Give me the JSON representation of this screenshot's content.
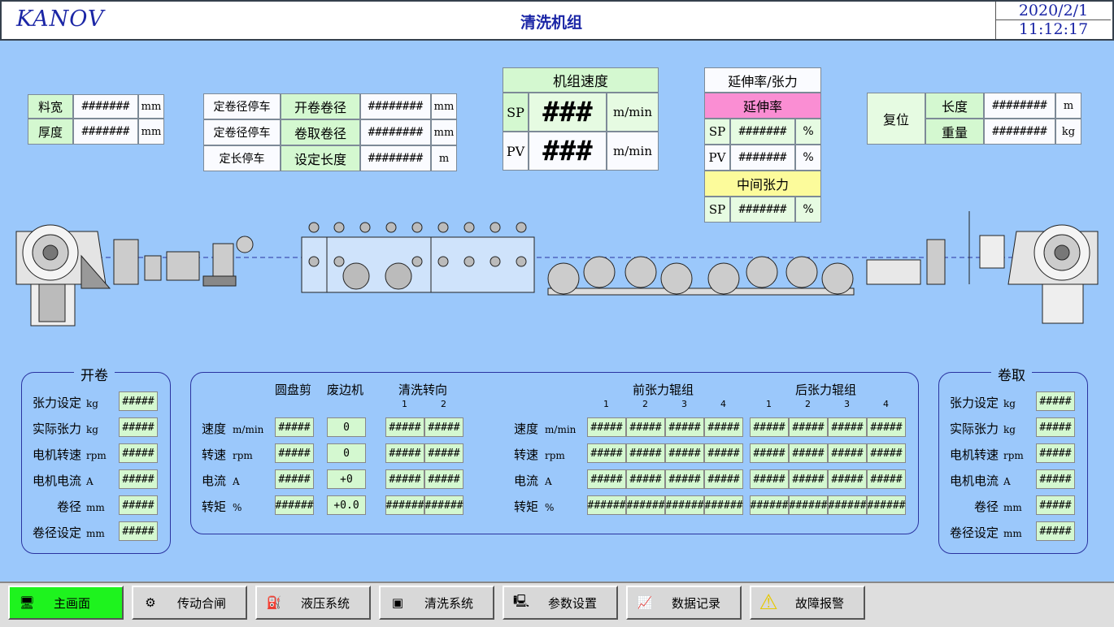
{
  "header": {
    "logo": "KANOV",
    "title": "清洗机组",
    "date": "2020/2/1",
    "time": "11:12:17"
  },
  "top_left": {
    "width_label": "料宽",
    "width_value": "#######",
    "width_unit": "mm",
    "thick_label": "厚度",
    "thick_value": "#######",
    "thick_unit": "mm"
  },
  "top_mid": {
    "rows": [
      {
        "btn": "定卷径停车",
        "label": "开卷卷径",
        "value": "########",
        "unit": "mm"
      },
      {
        "btn": "定卷径停车",
        "label": "卷取卷径",
        "value": "########",
        "unit": "mm"
      },
      {
        "btn": "定长停车",
        "label": "设定长度",
        "value": "########",
        "unit": "m"
      }
    ]
  },
  "speed": {
    "title": "机组速度",
    "sp_label": "SP",
    "sp_value": "###",
    "sp_unit": "m/min",
    "pv_label": "PV",
    "pv_value": "###",
    "pv_unit": "m/min"
  },
  "elong": {
    "mode": "延伸率/张力",
    "title": "延伸率",
    "sp_label": "SP",
    "sp_value": "#######",
    "pv_label": "PV",
    "pv_value": "#######",
    "unit": "%",
    "mid_title": "中间张力",
    "mid_sp_label": "SP",
    "mid_sp_value": "#######",
    "mid_unit": "%"
  },
  "top_right": {
    "reset": "复位",
    "len_label": "长度",
    "len_value": "########",
    "len_unit": "m",
    "wt_label": "重量",
    "wt_value": "########",
    "wt_unit": "kg"
  },
  "uncoil": {
    "title": "开卷",
    "rows": [
      {
        "label": "张力设定",
        "unit": "kg",
        "value": "#####"
      },
      {
        "label": "实际张力",
        "unit": "kg",
        "value": "#####"
      },
      {
        "label": "电机转速",
        "unit": "rpm",
        "value": "#####"
      },
      {
        "label": "电机电流",
        "unit": "A",
        "value": "#####"
      },
      {
        "label": "卷径",
        "unit": "mm",
        "value": "#####"
      },
      {
        "label": "卷径设定",
        "unit": "mm",
        "value": "#####"
      }
    ]
  },
  "recoil": {
    "title": "卷取",
    "rows": [
      {
        "label": "张力设定",
        "unit": "kg",
        "value": "#####"
      },
      {
        "label": "实际张力",
        "unit": "kg",
        "value": "#####"
      },
      {
        "label": "电机转速",
        "unit": "rpm",
        "value": "#####"
      },
      {
        "label": "电机电流",
        "unit": "A",
        "value": "#####"
      },
      {
        "label": "卷径",
        "unit": "mm",
        "value": "#####"
      },
      {
        "label": "卷径设定",
        "unit": "mm",
        "value": "#####"
      }
    ]
  },
  "center": {
    "col_shear": "圆盘剪",
    "col_scrap": "废边机",
    "col_wash": "清洗转向",
    "wash_nums": [
      "1",
      "2"
    ],
    "col_front": "前张力辊组",
    "col_back": "后张力辊组",
    "roll_nums": [
      "1",
      "2",
      "3",
      "4"
    ],
    "rows": [
      {
        "label": "速度",
        "unit": "m/min",
        "shear": "#####",
        "scrap": "0",
        "wash": [
          "#####",
          "#####"
        ],
        "front": [
          "#####",
          "#####",
          "#####",
          "#####"
        ],
        "back": [
          "#####",
          "#####",
          "#####",
          "#####"
        ]
      },
      {
        "label": "转速",
        "unit": "rpm",
        "shear": "#####",
        "scrap": "0",
        "wash": [
          "#####",
          "#####"
        ],
        "front": [
          "#####",
          "#####",
          "#####",
          "#####"
        ],
        "back": [
          "#####",
          "#####",
          "#####",
          "#####"
        ]
      },
      {
        "label": "电流",
        "unit": "A",
        "shear": "#####",
        "scrap": "+0",
        "wash": [
          "#####",
          "#####"
        ],
        "front": [
          "#####",
          "#####",
          "#####",
          "#####"
        ],
        "back": [
          "#####",
          "#####",
          "#####",
          "#####"
        ]
      },
      {
        "label": "转矩",
        "unit": "%",
        "shear": "######",
        "scrap": "+0.0",
        "wash": [
          "######",
          "######"
        ],
        "front": [
          "######",
          "######",
          "######",
          "######"
        ],
        "back": [
          "######",
          "######",
          "######",
          "######"
        ]
      }
    ]
  },
  "footer": [
    {
      "label": "主画面",
      "icon": "monitor-icon"
    },
    {
      "label": "传动合闸",
      "icon": "drive-icon"
    },
    {
      "label": "液压系统",
      "icon": "hydraulic-icon"
    },
    {
      "label": "清洗系统",
      "icon": "cleaning-icon"
    },
    {
      "label": "参数设置",
      "icon": "settings-computer-icon"
    },
    {
      "label": "数据记录",
      "icon": "data-log-icon"
    },
    {
      "label": "故障报警",
      "icon": "warning-icon"
    }
  ],
  "colors": {
    "background": "#9bc8fb",
    "field": "#d4f8d0",
    "active": "#1ef31e",
    "pink": "#fa8ed3",
    "yellow": "#fcfb9b",
    "navy": "#1b26a6"
  }
}
